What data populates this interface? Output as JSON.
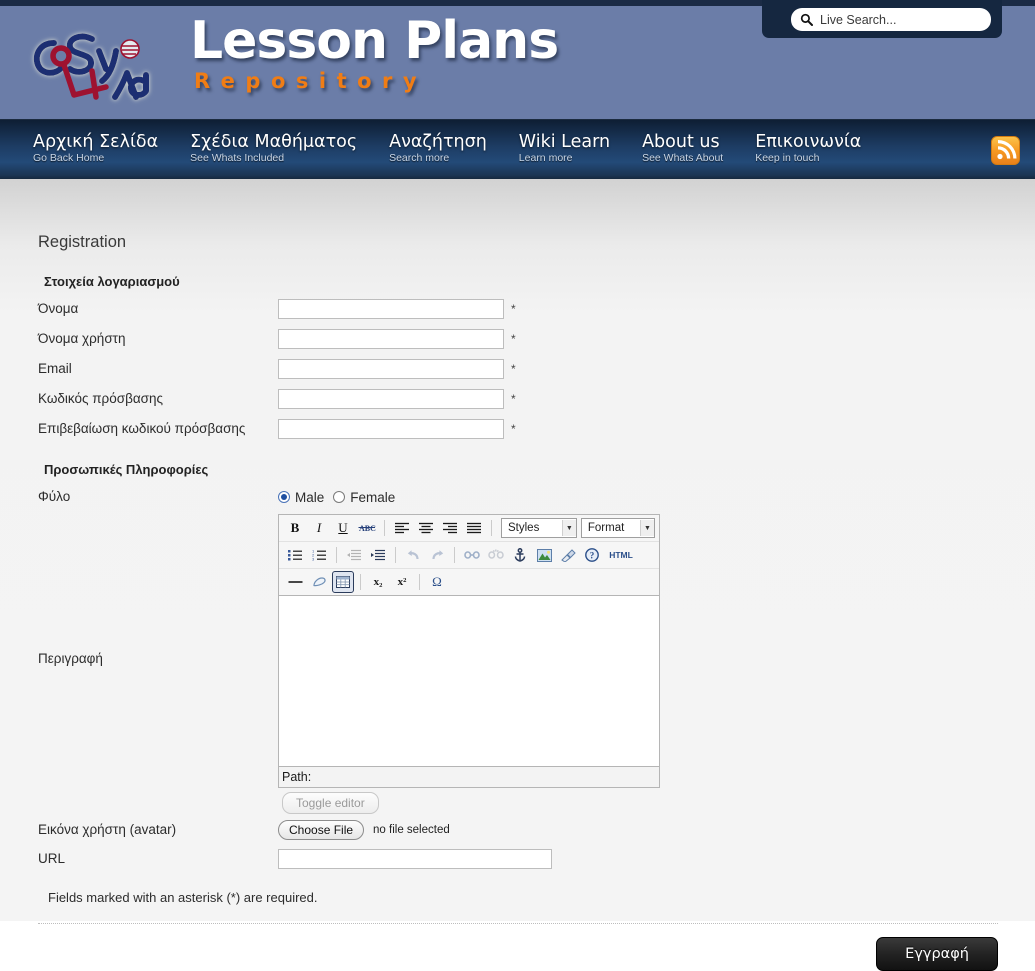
{
  "header": {
    "logo_alt": "CoSyLab",
    "brand_title": "Lesson Plans",
    "brand_subtitle": "Repository",
    "search": {
      "placeholder": "Live Search...",
      "value": "",
      "icon": "search-icon"
    },
    "colors": {
      "header_bg": "#6b7da8",
      "top_strip": "#1b2b45",
      "search_panel": "#152740",
      "accent_orange": "#f07d15",
      "nav_dark": "#0d1d32",
      "nav_light": "#234a78"
    }
  },
  "nav": {
    "items": [
      {
        "main": "Αρχική Σελίδα",
        "sub": "Go Back Home"
      },
      {
        "main": "Σχέδια Μαθήματος",
        "sub": "See Whats Included"
      },
      {
        "main": "Αναζήτηση",
        "sub": "Search more"
      },
      {
        "main": "Wiki Learn",
        "sub": "Learn more"
      },
      {
        "main": "About us",
        "sub": "See Whats About"
      },
      {
        "main": "Επικοινωνία",
        "sub": "Keep in touch"
      }
    ],
    "rss_icon": "rss-icon"
  },
  "page": {
    "title": "Registration",
    "account_legend": "Στοιχεία λογαριασμού",
    "personal_legend": "Προσωπικές Πληροφορίες",
    "required_marker": "*",
    "note": "Fields marked with an asterisk (*) are required.",
    "submit_label": "Εγγραφή"
  },
  "fields": {
    "name": {
      "label": "Όνομα",
      "value": "",
      "placeholder": ""
    },
    "username": {
      "label": "Όνομα χρήστη",
      "value": "",
      "placeholder": ""
    },
    "email": {
      "label": "Email",
      "value": "",
      "placeholder": ""
    },
    "password": {
      "label": "Κωδικός πρόσβασης",
      "value": "",
      "placeholder": ""
    },
    "confirm": {
      "label": "Επιβεβαίωση κωδικού πρόσβασης",
      "value": "",
      "placeholder": ""
    },
    "gender": {
      "label": "Φύλο",
      "options": [
        "Male",
        "Female"
      ],
      "selected": "Male"
    },
    "description": {
      "label": "Περιγραφή",
      "value": ""
    },
    "avatar": {
      "label": "Εικόνα χρήστη (avatar)",
      "button": "Choose File",
      "status": "no file selected"
    },
    "url": {
      "label": "URL",
      "value": "",
      "placeholder": ""
    }
  },
  "editor": {
    "path_label": "Path:",
    "toggle_label": "Toggle editor",
    "styles_select": {
      "label": "Styles",
      "value": "Styles"
    },
    "format_select": {
      "label": "Format",
      "value": "Format"
    },
    "row1": [
      {
        "name": "bold-icon",
        "glyph": "B",
        "style": "bold"
      },
      {
        "name": "italic-icon",
        "glyph": "I",
        "style": "italic"
      },
      {
        "name": "underline-icon",
        "glyph": "U",
        "style": "underline"
      },
      {
        "name": "strikethrough-icon",
        "glyph": "ABC",
        "style": "strike"
      }
    ],
    "row1_align": [
      {
        "name": "align-left-icon"
      },
      {
        "name": "align-center-icon"
      },
      {
        "name": "align-right-icon"
      },
      {
        "name": "align-justify-icon"
      }
    ],
    "row2": [
      {
        "name": "bullet-list-icon"
      },
      {
        "name": "numbered-list-icon"
      },
      {
        "name": "outdent-icon"
      },
      {
        "name": "indent-icon"
      },
      {
        "name": "undo-icon"
      },
      {
        "name": "redo-icon"
      },
      {
        "name": "link-icon"
      },
      {
        "name": "unlink-icon"
      },
      {
        "name": "anchor-icon"
      },
      {
        "name": "insert-image-icon"
      },
      {
        "name": "cleanup-icon"
      },
      {
        "name": "help-icon"
      },
      {
        "name": "html-source-icon",
        "glyph": "HTML"
      }
    ],
    "row3": [
      {
        "name": "horizontal-rule-icon"
      },
      {
        "name": "remove-format-icon"
      },
      {
        "name": "insert-table-icon",
        "selected": true
      },
      {
        "name": "subscript-icon",
        "glyph": "x₂"
      },
      {
        "name": "superscript-icon",
        "glyph": "x²"
      },
      {
        "name": "special-char-icon",
        "glyph": "Ω"
      }
    ]
  }
}
